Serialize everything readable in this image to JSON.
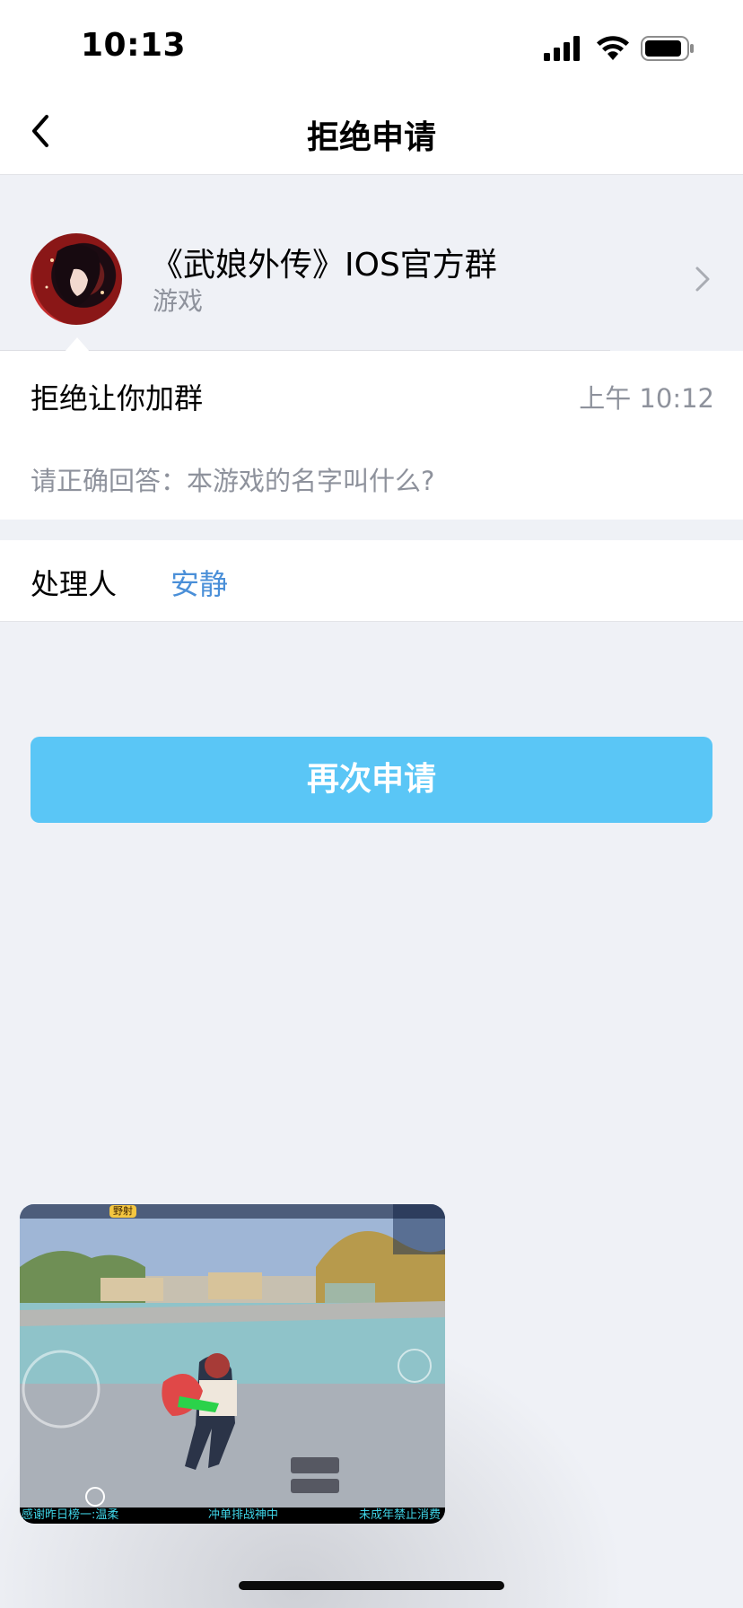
{
  "status_bar": {
    "time": "10:13"
  },
  "nav": {
    "title": "拒绝申请"
  },
  "group": {
    "name": "《武娘外传》IOS官方群",
    "category": "游戏"
  },
  "message": {
    "status": "拒绝让你加群",
    "time": "上午 10:12",
    "question": "请正确回答：本游戏的名字叫什么?"
  },
  "handler": {
    "label": "处理人",
    "name": "安静"
  },
  "actions": {
    "reapply_label": "再次申请"
  },
  "floating_video": {
    "badge": "野射",
    "ticker_left": "感谢昨日榜一:温柔",
    "ticker_center": "冲单排战神中",
    "ticker_right": "未成年禁止消费"
  },
  "colors": {
    "accent_button": "#5ac6f6",
    "link_blue": "#4a8fd8",
    "muted_text": "#8e929c",
    "page_background": "#eff1f6"
  },
  "icons": [
    "back-icon",
    "signal-icon",
    "wifi-icon",
    "battery-icon",
    "chevron-right-icon"
  ]
}
